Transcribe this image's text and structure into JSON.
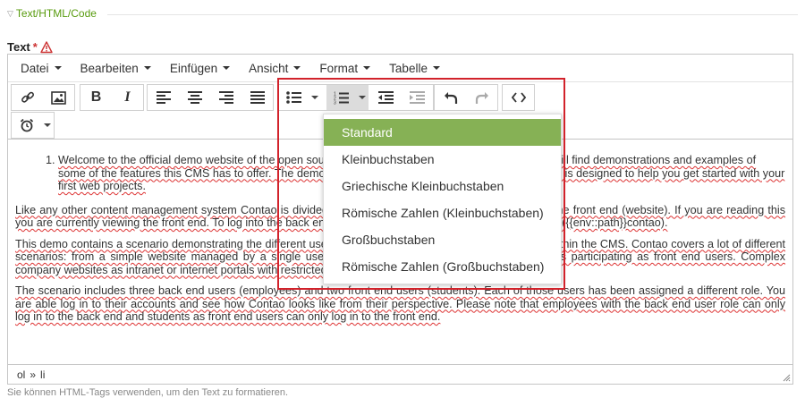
{
  "fieldset": {
    "legend": "Text/HTML/Code"
  },
  "field": {
    "label": "Text",
    "required_mark": "*",
    "help": "Sie können HTML-Tags verwenden, um den Text zu formatieren."
  },
  "menubar": {
    "items": [
      {
        "label": "Datei"
      },
      {
        "label": "Bearbeiten"
      },
      {
        "label": "Einfügen"
      },
      {
        "label": "Ansicht"
      },
      {
        "label": "Format"
      },
      {
        "label": "Tabelle"
      }
    ]
  },
  "toolbar": {
    "buttons": [
      "link-icon",
      "image-icon",
      "bold-icon",
      "italic-icon",
      "align-left-icon",
      "align-center-icon",
      "align-right-icon",
      "align-justify-icon",
      "bullet-list-icon",
      "numbered-list-icon",
      "outdent-icon",
      "indent-icon",
      "undo-icon",
      "redo-icon",
      "source-code-icon",
      "clock-icon"
    ],
    "bold_glyph": "B",
    "italic_glyph": "I"
  },
  "dropdown": {
    "items": [
      {
        "label": "Standard",
        "active": true
      },
      {
        "label": "Kleinbuchstaben"
      },
      {
        "label": "Griechische Kleinbuchstaben"
      },
      {
        "label": "Römische Zahlen (Kleinbuchstaben)"
      },
      {
        "label": "Großbuchstaben"
      },
      {
        "label": "Römische Zahlen (Großbuchstaben)"
      }
    ]
  },
  "content": {
    "list_item": "Welcome to the official demo website of the open source CMS Contao. On the following pages you will find demonstrations and examples of some of the features this CMS has to offer. The demo is included in every installation of the CMS and is designed to help you get started with your first web projects.",
    "paragraphs": [
      "Like any other content management system Contao is divided into the back end (administration area) and the front end (website). If you are reading this you are currently viewing the front end. To log into the back end, simply append /contao to the URL of the site ({{env::path}}contao).",
      "This demo contains a scenario demonstrating the different user groups with the respective roles and rights within the CMS. Contao covers a lot of different scenarios: from a simple website managed by a single user up to a large platform with a lot of members participating as front end users. Complex company websites as intranet or internet portals with restricted areas can be realized as well.",
      "The scenario includes three back end users (employees) and two front end users (students). Each of those users has been assigned a different role. You are able log in to their accounts and see how Contao looks like from their perspective. Please note that employees with the back end user role can only log in to the back end and students as front end users can only log in to the front end."
    ]
  },
  "statusbar": {
    "path_0": "ol",
    "separator": "»",
    "path_1": "li"
  },
  "colors": {
    "accent_green": "#86b155",
    "legend_green": "#589b0e",
    "highlight_red": "#d2222b"
  }
}
